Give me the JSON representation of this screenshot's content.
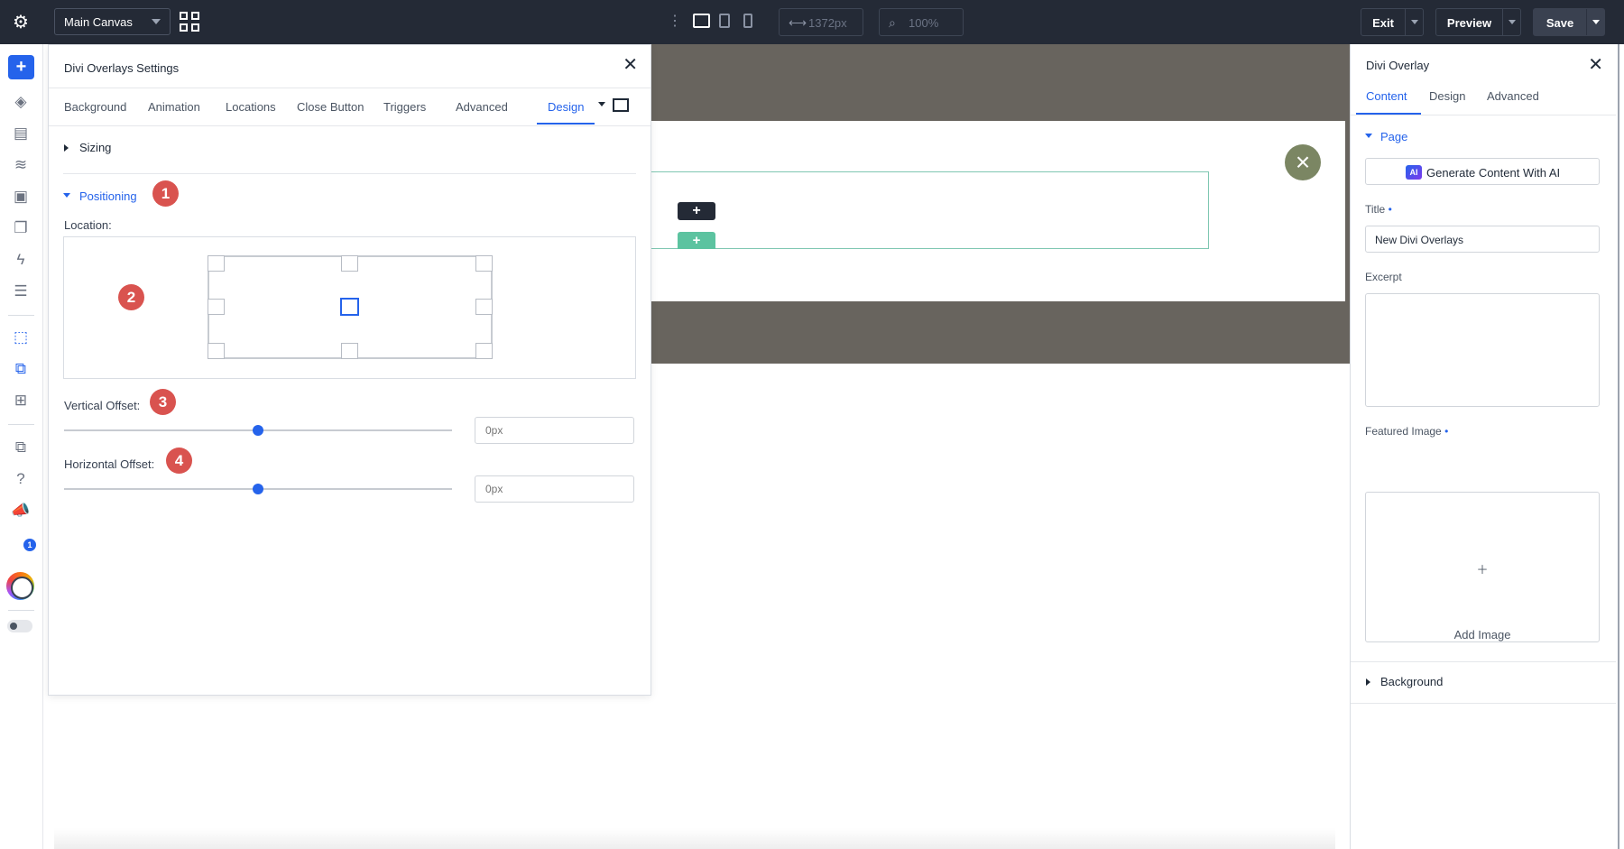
{
  "topbar": {
    "canvas_select": "Main Canvas",
    "width_value": "1372px",
    "zoom_value": "100%",
    "exit_label": "Exit",
    "preview_label": "Preview",
    "save_label": "Save"
  },
  "modal": {
    "title": "Divi Overlays Settings",
    "tabs": [
      "Background",
      "Animation",
      "Locations",
      "Close Button",
      "Triggers",
      "Advanced",
      "Design"
    ],
    "active_tab": "Design",
    "sizing_label": "Sizing",
    "positioning_label": "Positioning",
    "location_label": "Location:",
    "vertical_offset_label": "Vertical Offset:",
    "horizontal_offset_label": "Horizontal Offset:",
    "vertical_offset_placeholder": "0px",
    "horizontal_offset_placeholder": "0px",
    "vertical_offset_value_fraction": 0.5,
    "horizontal_offset_value_fraction": 0.5,
    "selected_location": "center",
    "callouts": [
      "1",
      "2",
      "3",
      "4"
    ]
  },
  "right_panel": {
    "title": "Divi Overlay",
    "tabs": [
      "Content",
      "Design",
      "Advanced"
    ],
    "active_tab": "Content",
    "page_section": "Page",
    "ai_button": "Generate Content With AI",
    "ai_icon_text": "AI",
    "title_label": "Title",
    "title_value": "New Divi Overlays",
    "excerpt_label": "Excerpt",
    "featured_image_label": "Featured Image",
    "add_image_label": "Add Image",
    "background_section": "Background",
    "required_marker": "•"
  },
  "rail": {
    "notification_count": "1"
  },
  "colors": {
    "accent": "#2563eb",
    "topbar": "#242a36",
    "callout": "#d9534f",
    "canvas_band": "#68645e",
    "close_circle": "#7b8663",
    "row_outline": "#7fc7b2"
  }
}
